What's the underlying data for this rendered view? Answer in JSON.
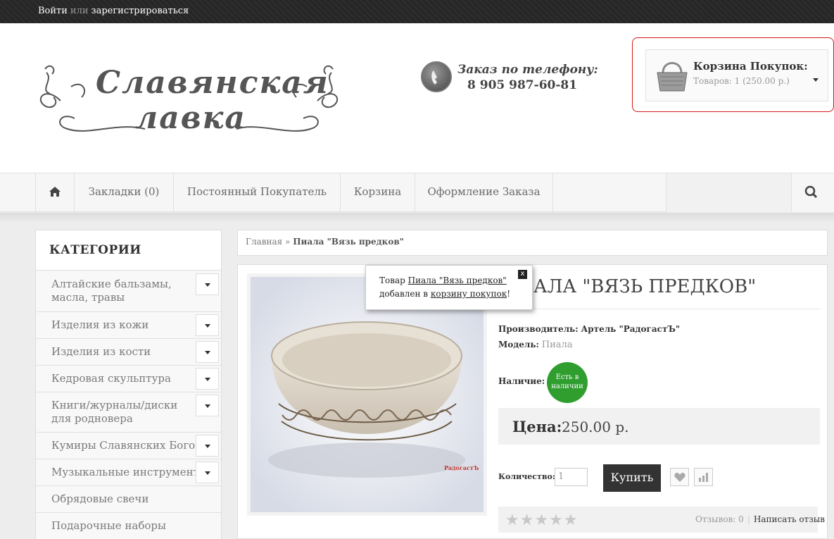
{
  "topbar": {
    "login": "Войти",
    "or": "или",
    "register": "зарегистрироваться"
  },
  "logo": {
    "line1": "Славянская",
    "line2": "лавка"
  },
  "phone": {
    "label": "Заказ по телефону:",
    "number": "8 905 987-60-81"
  },
  "cart": {
    "title": "Корзина Покупок:",
    "summary": "Товаров: 1 (250.00 р.)"
  },
  "nav": {
    "items": [
      {
        "label": "Закладки (0)"
      },
      {
        "label": "Постоянный Покупатель"
      },
      {
        "label": "Корзина"
      },
      {
        "label": "Оформление Заказа"
      }
    ]
  },
  "categories": {
    "title": "КАТЕГОРИИ",
    "items": [
      {
        "label": "Алтайские бальзамы, масла, травы"
      },
      {
        "label": "Изделия из кожи"
      },
      {
        "label": "Изделия из кости"
      },
      {
        "label": "Кедровая скульптура"
      },
      {
        "label": "Книги/журналы/диски для родновера"
      },
      {
        "label": "Кумиры Славянских Богов"
      },
      {
        "label": "Музыкальные инструменты"
      },
      {
        "label": "Обрядовые свечи"
      },
      {
        "label": "Подарочные наборы"
      }
    ]
  },
  "breadcrumb": {
    "home": "Главная",
    "sep": " » ",
    "current": "Пиала \"Вязь предков\""
  },
  "product": {
    "title": "АЛА \"ВЯЗЬ ПРЕДКОВ\"",
    "manufacturer_label": "Производитель:",
    "manufacturer": "Артель \"РадогастЪ\"",
    "model_label": "Модель:",
    "model": "Пиала",
    "availability_label": "Наличие:",
    "availability": "Есть в наличии",
    "price_label": "Цена:",
    "price": "250.00 р.",
    "qty_label": "Количество:",
    "qty": "1",
    "buy": "Купить",
    "stars": "★★★★★",
    "reviews": "Отзывов: 0",
    "write_review": "Написать отзыв",
    "watermark": "РадогастЪ"
  },
  "popup": {
    "prefix": "Товар ",
    "product_link": "Пиала \"Вязь предков\"",
    "middle": "добавлен в ",
    "cart_link": "корзину покупок",
    "suffix": "!",
    "close": "x"
  }
}
